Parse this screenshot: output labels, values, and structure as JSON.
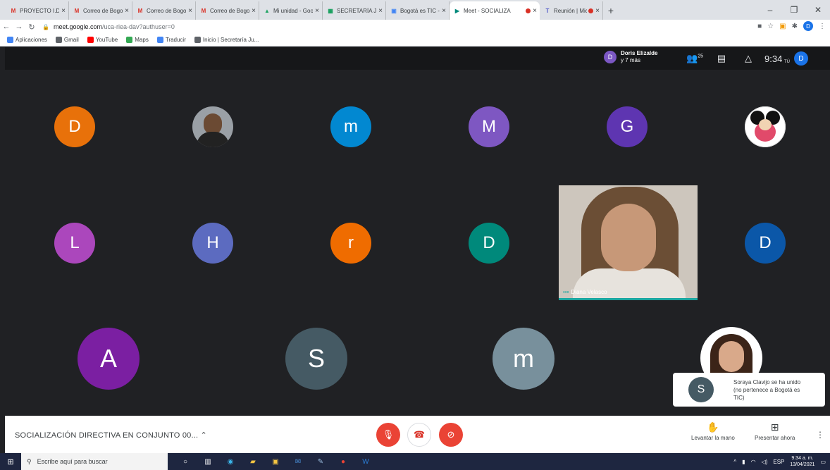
{
  "browser": {
    "tabs": [
      {
        "title": "PROYECTO I.D Y ARCH",
        "favicon": "gmail-icon",
        "active": false
      },
      {
        "title": "Correo de Bogotá es TI",
        "favicon": "gmail-icon",
        "active": false
      },
      {
        "title": "Correo de Bogotá es TI",
        "favicon": "gmail-icon",
        "active": false
      },
      {
        "title": "Correo de Bogotá es TI",
        "favicon": "gmail-icon",
        "active": false
      },
      {
        "title": "Mi unidad - Google Dr",
        "favicon": "drive-icon",
        "active": false
      },
      {
        "title": "SECRETARÍA JURÍDICA",
        "favicon": "sheets-icon",
        "active": false
      },
      {
        "title": "Bogotá es TIC - Calend",
        "favicon": "calendar-icon",
        "active": false
      },
      {
        "title": "Meet - SOCIALIZA",
        "favicon": "meet-icon",
        "active": true
      },
      {
        "title": "Reunión | Microsof",
        "favicon": "teams-icon",
        "active": false
      }
    ],
    "url_domain": "meet.google.com",
    "url_path": "/uca-riea-dav?authuser=0",
    "profile_initial": "D",
    "bookmarks": [
      {
        "label": "Aplicaciones",
        "color": "#4285f4"
      },
      {
        "label": "Gmail",
        "color": "#5f6368"
      },
      {
        "label": "YouTube",
        "color": "#ff0000"
      },
      {
        "label": "Maps",
        "color": "#34a853"
      },
      {
        "label": "Traducir",
        "color": "#4285f4"
      },
      {
        "label": "Inicio | Secretaría Ju...",
        "color": "#5f6368"
      }
    ]
  },
  "meet": {
    "presenter": {
      "initial": "D",
      "name": "Doris Elizalde",
      "others": "y 7 más"
    },
    "participants_count": "25",
    "clock": "9:34",
    "self_label": "TÚ",
    "self_initial": "D",
    "tiles": [
      {
        "initial": "D",
        "color": "#e8710a"
      },
      {
        "initial": "",
        "color": "#4a4a4a"
      },
      {
        "initial": "m",
        "color": "#0288d1"
      },
      {
        "initial": "M",
        "color": "#7e57c2"
      },
      {
        "initial": "G",
        "color": "#5e35b1"
      },
      {
        "initial": "",
        "color": "#ffffff"
      },
      {
        "initial": "L",
        "color": "#ab47bc"
      },
      {
        "initial": "H",
        "color": "#5c6bc0"
      },
      {
        "initial": "r",
        "color": "#ef6c00"
      },
      {
        "initial": "D",
        "color": "#00897b"
      },
      {
        "initial": "D",
        "color": "#0b57a8"
      },
      {
        "initial": "A",
        "color": "#7b1fa2"
      },
      {
        "initial": "S",
        "color": "#455a64"
      },
      {
        "initial": "m",
        "color": "#78909c"
      }
    ],
    "video_name": "Diana Velasco",
    "toast": {
      "initial": "S",
      "text1": "Soraya Clavijo se ha unido",
      "text2": "(no pertenece a Bogotá es",
      "text3": "TIC)"
    },
    "meeting_name": "SOCIALIZACIÓN DIRECTIVA EN CONJUNTO 00...",
    "raise_hand_label": "Levantar la mano",
    "present_label": "Presentar ahora"
  },
  "taskbar": {
    "search_placeholder": "Escribe aquí para buscar",
    "language": "ESP",
    "time": "9:34 a. m.",
    "date": "13/04/2021"
  }
}
